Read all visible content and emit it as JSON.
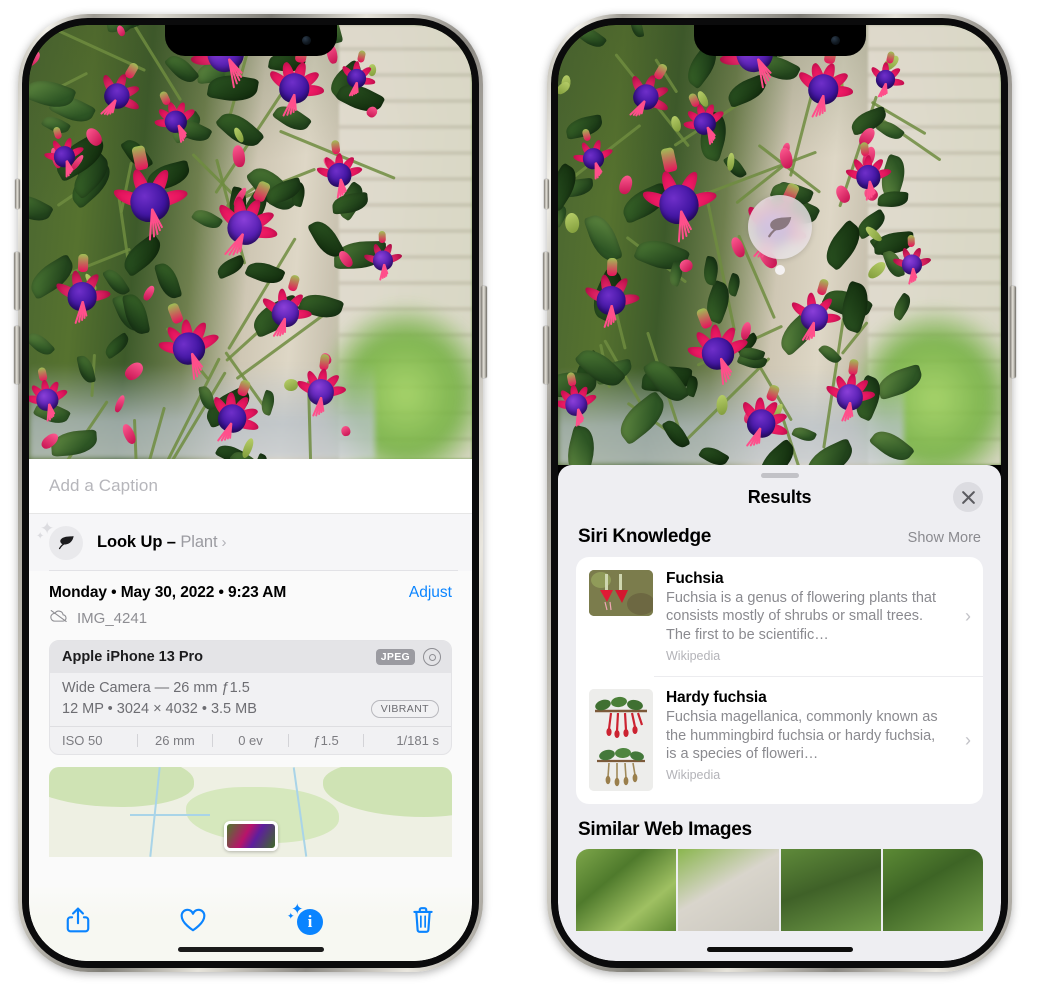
{
  "left_phone": {
    "caption_placeholder": "Add a Caption",
    "lookup": {
      "label": "Look Up",
      "dash": " – ",
      "subject": "Plant",
      "chevron": "›",
      "sparkle": "✦",
      "sparkle_small": "✦",
      "leaf_icon": "leaf-icon"
    },
    "meta": {
      "date": "Monday • May 30, 2022 • 9:23 AM",
      "adjust_label": "Adjust",
      "filename": "IMG_4241",
      "cloud_icon": "cloud-slash-icon"
    },
    "exif": {
      "device": "Apple iPhone 13 Pro",
      "format_badge": "JPEG",
      "raw_icon": "aperture-icon",
      "lens_line": "Wide Camera — 26 mm ƒ1.5",
      "size_line": "12 MP • 3024 × 4032 • 3.5 MB",
      "style_badge": "VIBRANT",
      "settings": [
        "ISO 50",
        "26 mm",
        "0 ev",
        "ƒ1.5",
        "1/181 s"
      ]
    },
    "toolbar": {
      "share_label": "share-icon",
      "favorite_label": "heart-icon",
      "info_label": "info-icon",
      "info_glyph": "i",
      "delete_label": "trash-icon"
    }
  },
  "right_phone": {
    "visual_lookup_badge": "leaf-icon",
    "sheet": {
      "title": "Results",
      "close_label": "×"
    },
    "siri_knowledge": {
      "section_title": "Siri Knowledge",
      "show_more": "Show More",
      "items": [
        {
          "title": "Fuchsia",
          "description": "Fuchsia is a genus of flowering plants that consists mostly of shrubs or small trees. The first to be scientific…",
          "source": "Wikipedia",
          "chevron": "›"
        },
        {
          "title": "Hardy fuchsia",
          "description": "Fuchsia magellanica, commonly known as the hummingbird fuchsia or hardy fuchsia, is a species of floweri…",
          "source": "Wikipedia",
          "chevron": "›"
        }
      ]
    },
    "similar_web_images": {
      "section_title": "Similar Web Images",
      "count": 4
    }
  },
  "colors": {
    "accent_blue": "#0a84ff",
    "sheet_bg": "#eeeef2",
    "card_bg": "#ffffff",
    "secondary_text": "#8a8a8f"
  }
}
